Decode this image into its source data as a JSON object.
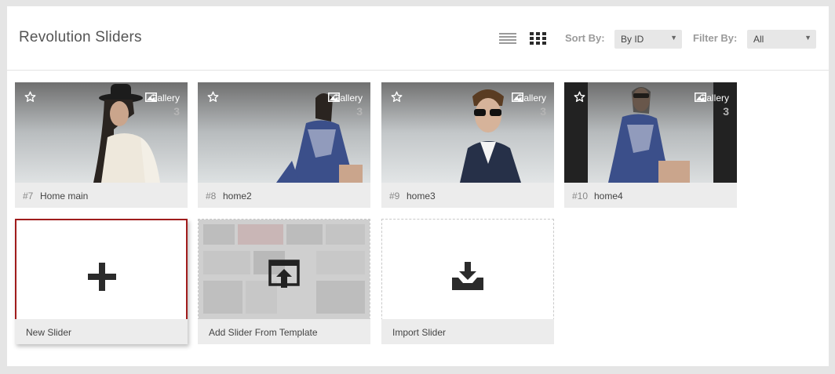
{
  "header": {
    "title": "Revolution Sliders",
    "sort_label": "Sort By:",
    "sort_value": "By ID",
    "filter_label": "Filter By:",
    "filter_value": "All"
  },
  "sliders": [
    {
      "id": "#7",
      "name": "Home main",
      "type": "Gallery",
      "count": "3"
    },
    {
      "id": "#8",
      "name": "home2",
      "type": "Gallery",
      "count": "3"
    },
    {
      "id": "#9",
      "name": "home3",
      "type": "Gallery",
      "count": "3"
    },
    {
      "id": "#10",
      "name": "home4",
      "type": "Gallery",
      "count": "3"
    }
  ],
  "actions": {
    "new_slider": "New Slider",
    "add_from_template": "Add Slider From Template",
    "import_slider": "Import Slider"
  },
  "colors": {
    "highlight_border": "#a01c1c",
    "bar_background": "#ececec",
    "icon_dark": "#2b2b2b"
  }
}
